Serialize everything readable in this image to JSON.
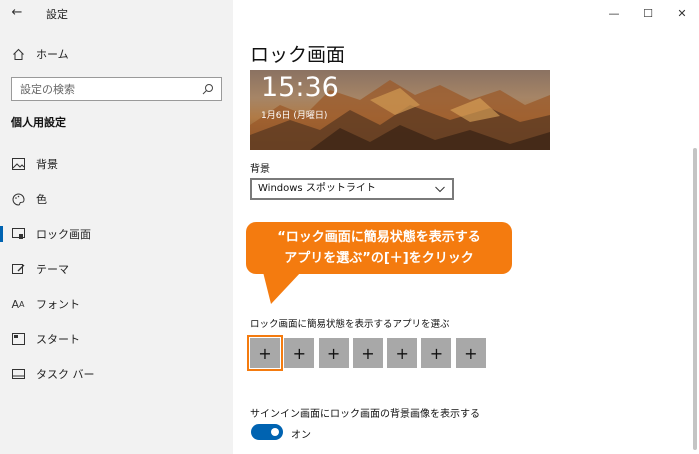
{
  "app": {
    "title": "設定",
    "back_icon": "back-arrow-icon"
  },
  "window": {
    "minimize": "—",
    "maximize": "☐",
    "close": "✕"
  },
  "sidebar": {
    "home_label": "ホーム",
    "search_placeholder": "設定の検索",
    "section_title": "個人用設定",
    "items": [
      {
        "label": "背景",
        "icon": "picture-icon"
      },
      {
        "label": "色",
        "icon": "palette-icon"
      },
      {
        "label": "ロック画面",
        "icon": "lock-screen-icon",
        "active": true
      },
      {
        "label": "テーマ",
        "icon": "theme-icon"
      },
      {
        "label": "フォント",
        "icon": "font-icon"
      },
      {
        "label": "スタート",
        "icon": "start-icon"
      },
      {
        "label": "タスク バー",
        "icon": "taskbar-icon"
      }
    ]
  },
  "main": {
    "page_title": "ロック画面",
    "preview": {
      "time": "15:36",
      "date": "1月6日 (月曜日)"
    },
    "background_label": "背景",
    "background_value": "Windows スポットライト",
    "callout_line1": "“ロック画面に簡易状態を表示する",
    "callout_line2": "アプリを選ぶ”の[＋]をクリック",
    "apps_label": "ロック画面に簡易状態を表示するアプリを選ぶ",
    "app_buttons": [
      "+",
      "+",
      "+",
      "+",
      "+",
      "+",
      "+"
    ],
    "signin_label": "サインイン画面にロック画面の背景画像を表示する",
    "toggle_state": "オン"
  },
  "colors": {
    "accent": "#0063b1",
    "callout": "#f47b0f",
    "sidebar_bg": "#f2f2f2",
    "app_button": "#a8a8a8"
  }
}
